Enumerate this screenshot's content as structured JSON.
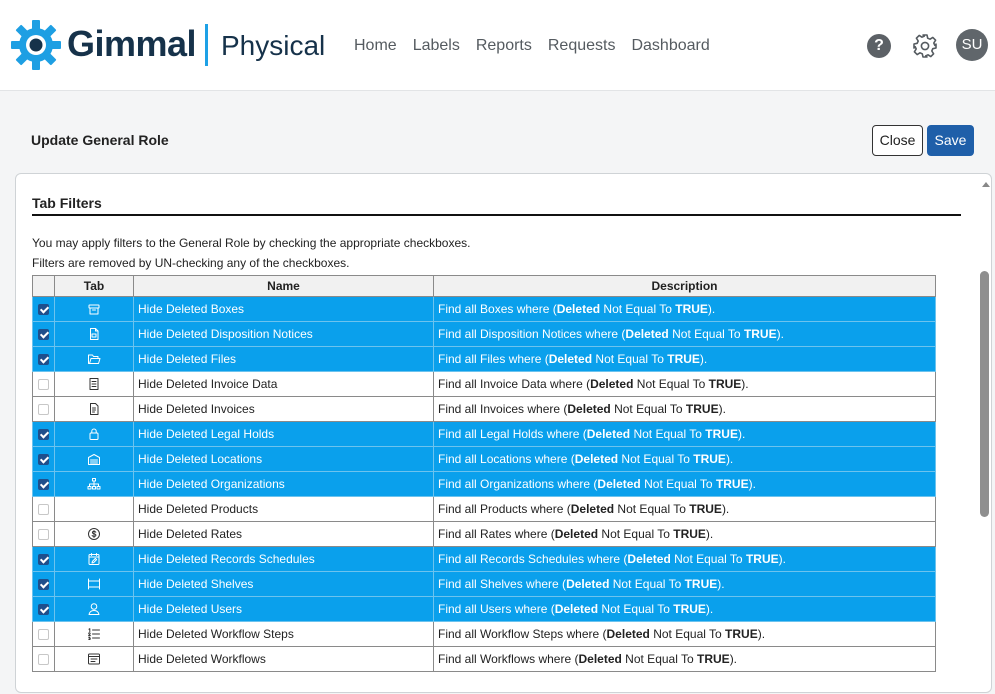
{
  "header": {
    "brand": "Gimmal",
    "product": "Physical",
    "nav": [
      "Home",
      "Labels",
      "Reports",
      "Requests",
      "Dashboard"
    ],
    "help_label": "?",
    "avatar_initials": "SU"
  },
  "page": {
    "title": "Update General Role",
    "close_label": "Close",
    "save_label": "Save"
  },
  "panel": {
    "title": "Tab Filters",
    "intro_line1": "You may apply filters to the General Role by checking the appropriate checkboxes.",
    "intro_line2": "Filters are removed by UN-checking any of the checkboxes.",
    "columns": [
      "",
      "Tab",
      "Name",
      "Description"
    ]
  },
  "colors": {
    "selected_row": "#0aa0ec",
    "save_button": "#1f5fa9",
    "brand_text": "#16324a",
    "brand_accent": "#1ea1e6"
  },
  "rows": [
    {
      "checked": true,
      "icon": "box-icon",
      "name": "Hide Deleted Boxes",
      "d_pre": "Find all Boxes where (",
      "d_b1": "Deleted",
      "d_mid": " Not Equal To ",
      "d_b2": "TRUE",
      "d_post": ")."
    },
    {
      "checked": true,
      "icon": "document-icon",
      "name": "Hide Deleted Disposition Notices",
      "d_pre": "Find all Disposition Notices where (",
      "d_b1": "Deleted",
      "d_mid": " Not Equal To ",
      "d_b2": "TRUE",
      "d_post": ")."
    },
    {
      "checked": true,
      "icon": "folder-icon",
      "name": "Hide Deleted Files",
      "d_pre": "Find all Files where (",
      "d_b1": "Deleted",
      "d_mid": " Not Equal To ",
      "d_b2": "TRUE",
      "d_post": ")."
    },
    {
      "checked": false,
      "icon": "invoice-icon",
      "name": "Hide Deleted Invoice Data",
      "d_pre": "Find all Invoice Data where (",
      "d_b1": "Deleted",
      "d_mid": " Not Equal To ",
      "d_b2": "TRUE",
      "d_post": ")."
    },
    {
      "checked": false,
      "icon": "receipt-icon",
      "name": "Hide Deleted Invoices",
      "d_pre": "Find all Invoices where (",
      "d_b1": "Deleted",
      "d_mid": " Not Equal To ",
      "d_b2": "TRUE",
      "d_post": ")."
    },
    {
      "checked": true,
      "icon": "lock-icon",
      "name": "Hide Deleted Legal Holds",
      "d_pre": "Find all Legal Holds where (",
      "d_b1": "Deleted",
      "d_mid": " Not Equal To ",
      "d_b2": "TRUE",
      "d_post": ")."
    },
    {
      "checked": true,
      "icon": "warehouse-icon",
      "name": "Hide Deleted Locations",
      "d_pre": "Find all Locations where (",
      "d_b1": "Deleted",
      "d_mid": " Not Equal To ",
      "d_b2": "TRUE",
      "d_post": ")."
    },
    {
      "checked": true,
      "icon": "org-chart-icon",
      "name": "Hide Deleted Organizations",
      "d_pre": "Find all Organizations where (",
      "d_b1": "Deleted",
      "d_mid": " Not Equal To ",
      "d_b2": "TRUE",
      "d_post": ")."
    },
    {
      "checked": false,
      "icon": "",
      "name": "Hide Deleted Products",
      "d_pre": "Find all Products where (",
      "d_b1": "Deleted",
      "d_mid": " Not Equal To ",
      "d_b2": "TRUE",
      "d_post": ")."
    },
    {
      "checked": false,
      "icon": "dollar-coin-icon",
      "name": "Hide Deleted Rates",
      "d_pre": "Find all Rates where (",
      "d_b1": "Deleted",
      "d_mid": " Not Equal To ",
      "d_b2": "TRUE",
      "d_post": ")."
    },
    {
      "checked": true,
      "icon": "calendar-edit-icon",
      "name": "Hide Deleted Records Schedules",
      "d_pre": "Find all Records Schedules where (",
      "d_b1": "Deleted",
      "d_mid": " Not Equal To ",
      "d_b2": "TRUE",
      "d_post": ")."
    },
    {
      "checked": true,
      "icon": "shelf-icon",
      "name": "Hide Deleted Shelves",
      "d_pre": "Find all Shelves where (",
      "d_b1": "Deleted",
      "d_mid": " Not Equal To ",
      "d_b2": "TRUE",
      "d_post": ")."
    },
    {
      "checked": true,
      "icon": "user-icon",
      "name": "Hide Deleted Users",
      "d_pre": "Find all Users where (",
      "d_b1": "Deleted",
      "d_mid": " Not Equal To ",
      "d_b2": "TRUE",
      "d_post": ")."
    },
    {
      "checked": false,
      "icon": "list-steps-icon",
      "name": "Hide Deleted Workflow Steps",
      "d_pre": "Find all Workflow Steps where (",
      "d_b1": "Deleted",
      "d_mid": " Not Equal To ",
      "d_b2": "TRUE",
      "d_post": ")."
    },
    {
      "checked": false,
      "icon": "workflow-icon",
      "name": "Hide Deleted Workflows",
      "d_pre": "Find all Workflows where (",
      "d_b1": "Deleted",
      "d_mid": " Not Equal To ",
      "d_b2": "TRUE",
      "d_post": ")."
    }
  ]
}
